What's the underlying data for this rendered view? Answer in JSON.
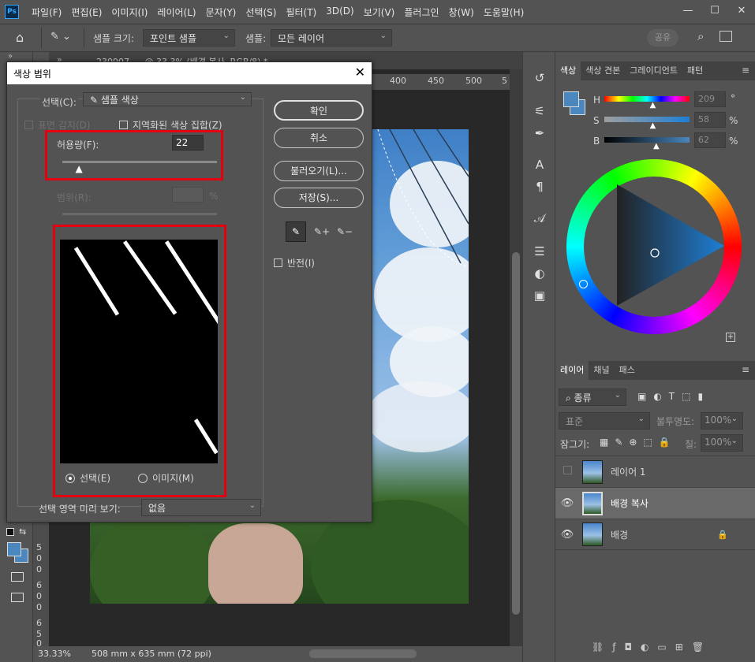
{
  "app": {
    "logo": "Ps"
  },
  "menu": [
    "파일(F)",
    "편집(E)",
    "이미지(I)",
    "레이어(L)",
    "문자(Y)",
    "선택(S)",
    "필터(T)",
    "3D(D)",
    "보기(V)",
    "플러그인",
    "창(W)",
    "도움말(H)"
  ],
  "window_controls": {
    "minimize": "—",
    "restore": "☐",
    "close": "✕"
  },
  "options_bar": {
    "sample_size_label": "샘플 크기:",
    "sample_size_value": "포인트 샘플",
    "sample_label": "샘플:",
    "sample_value": "모든 레이어",
    "share_label": "공유"
  },
  "doc_tab": {
    "title": "230907_... @ 33.3% (배경 복사, RGB/8) *"
  },
  "ruler": {
    "h_ticks": [
      "400",
      "450",
      "500",
      "5"
    ],
    "v_ticks": [
      "5",
      "0",
      "0",
      "6",
      "0",
      "0",
      "6",
      "5",
      "0"
    ]
  },
  "status": {
    "zoom": "33.33%",
    "size": "508 mm x 635 mm (72 ppi)"
  },
  "dialog": {
    "title": "색상 범위",
    "select_label": "선택(C):",
    "select_value": "샘플 색상",
    "detect_faces": "표면 감지(D)",
    "localized": "지역화된 색상 집합(Z)",
    "fuzziness_label": "허용량(F):",
    "fuzziness_value": "22",
    "fuzziness_slider": 0.11,
    "range_label": "범위(R):",
    "range_unit": "%",
    "ok": "확인",
    "cancel": "취소",
    "load": "불러오기(L)...",
    "save": "저장(S)...",
    "invert": "반전(I)",
    "radio_selection": "선택(E)",
    "radio_image": "이미지(M)",
    "preview_label": "선택 영역 미리 보기:",
    "preview_value": "없음"
  },
  "color_panel": {
    "tabs": [
      "색상",
      "색상 견본",
      "그레이디언트",
      "패턴"
    ],
    "h_label": "H",
    "h_value": "209",
    "h_unit": "°",
    "s_label": "S",
    "s_value": "58",
    "s_unit": "%",
    "b_label": "B",
    "b_value": "62",
    "b_unit": "%",
    "fg_color": "#4a87be",
    "bg_color": "#4a87be",
    "h_level": 0.58,
    "s_level": 0.58,
    "b_level": 0.62
  },
  "layers_panel": {
    "tabs": [
      "레이어",
      "채널",
      "패스"
    ],
    "filter_label": "종류",
    "blend_mode": "표준",
    "opacity_label": "불투명도:",
    "opacity_value": "100%",
    "lock_label": "잠그기:",
    "fill_label": "칠:",
    "fill_value": "100%",
    "layers": [
      {
        "name": "레이어 1",
        "visible": false,
        "selected": false,
        "locked": false
      },
      {
        "name": "배경 복사",
        "visible": true,
        "selected": true,
        "locked": false
      },
      {
        "name": "배경",
        "visible": true,
        "selected": false,
        "locked": true
      }
    ]
  }
}
